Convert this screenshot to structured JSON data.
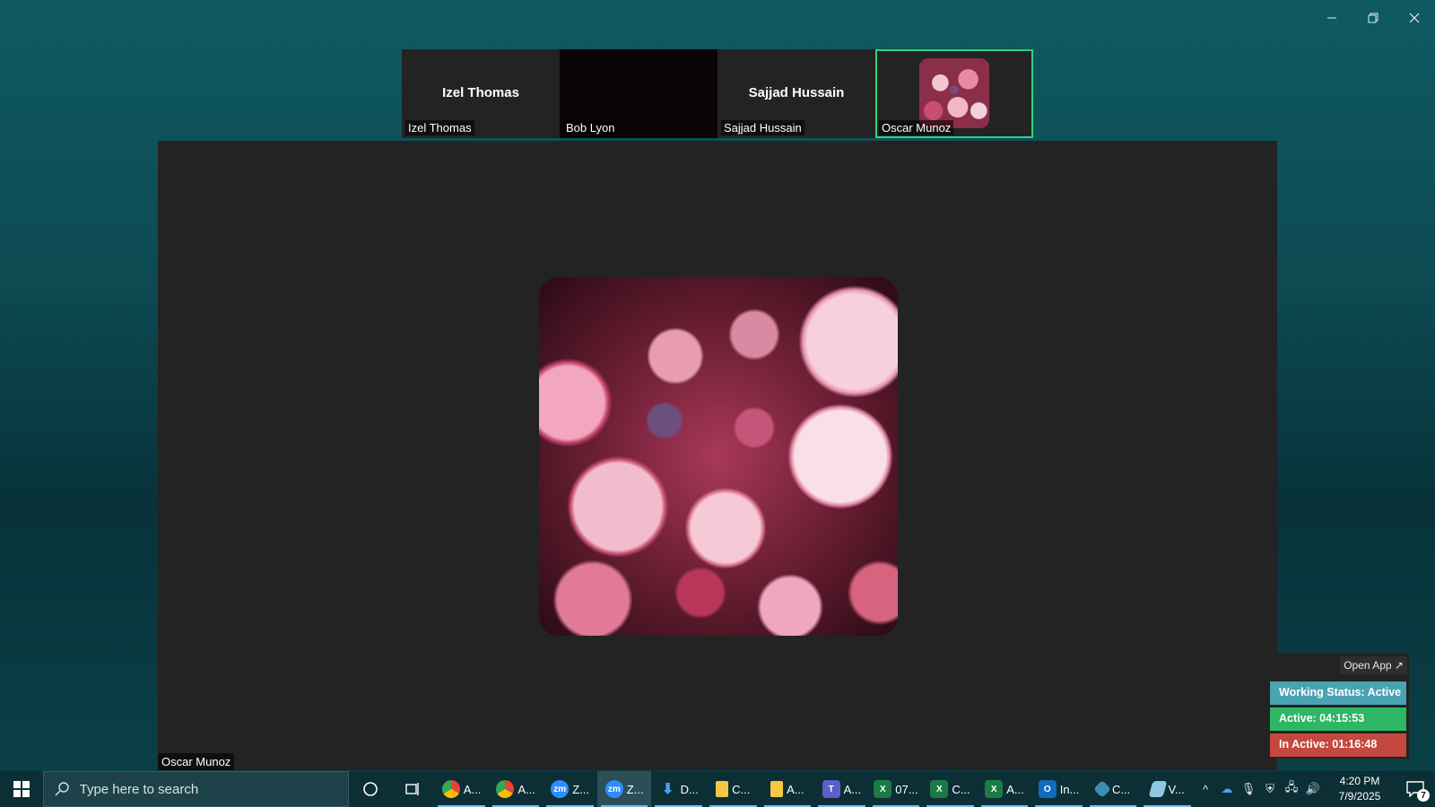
{
  "window": {
    "controls": [
      "minimize",
      "restore",
      "close"
    ]
  },
  "participants": [
    {
      "name_center": "Izel Thomas",
      "label": "Izel Thomas",
      "video": "off"
    },
    {
      "name_center": "",
      "label": "Bob Lyon",
      "video": "dark"
    },
    {
      "name_center": "Sajjad Hussain",
      "label": "Sajjad Hussain",
      "video": "off"
    },
    {
      "name_center": "",
      "label": "Oscar Munoz",
      "video": "avatar",
      "active_speaker": true
    }
  ],
  "main_stage": {
    "speaker_label": "Oscar Munoz"
  },
  "status_widget": {
    "open_app": "Open App ↗",
    "working_status": "Working Status: Active",
    "active": "Active: 04:15:53",
    "inactive": "In Active: 01:16:48",
    "colors": {
      "working": "#4aa3b2",
      "active": "#2db664",
      "inactive": "#c4483f"
    }
  },
  "taskbar": {
    "search_placeholder": "Type here to search",
    "items": [
      {
        "icon": "chrome-icon",
        "label": "A..."
      },
      {
        "icon": "chrome-icon",
        "label": "A..."
      },
      {
        "icon": "zoom-icon",
        "label": "Z..."
      },
      {
        "icon": "zoom-icon",
        "label": "Z...",
        "active": true
      },
      {
        "icon": "download-icon",
        "label": "D..."
      },
      {
        "icon": "folder-icon",
        "label": "C..."
      },
      {
        "icon": "folder-icon",
        "label": "A..."
      },
      {
        "icon": "teams-icon",
        "label": "A..."
      },
      {
        "icon": "excel-icon",
        "label": "07..."
      },
      {
        "icon": "excel-icon",
        "label": "C..."
      },
      {
        "icon": "excel-icon",
        "label": "A..."
      },
      {
        "icon": "outlook-icon",
        "label": "In..."
      },
      {
        "icon": "app-icon",
        "label": "C..."
      },
      {
        "icon": "app-icon",
        "label": "V..."
      }
    ],
    "clock_time": "4:20 PM",
    "clock_date": "7/9/2025",
    "notification_count": "7"
  }
}
